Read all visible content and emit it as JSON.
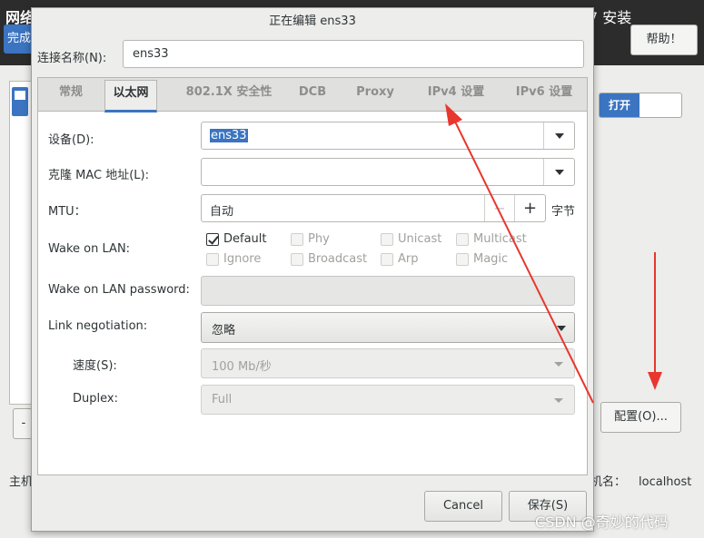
{
  "background": {
    "title_left": "网络和主机名",
    "done_button": "完成",
    "title_right": "7 安装",
    "help_button": "帮助！",
    "toggle_on_label": "打开",
    "minus_button": "-",
    "configure_button": "配置(O)...",
    "hostname_label_left": "主机",
    "hostname_label_right": "机名：",
    "hostname_value": "localhost"
  },
  "dialog": {
    "title": "正在编辑 ens33",
    "connection_name_label": "连接名称(N):",
    "connection_name_value": "ens33",
    "tabs": [
      "常规",
      "以太网",
      "802.1X 安全性",
      "DCB",
      "Proxy",
      "IPv4 设置",
      "IPv6 设置"
    ],
    "active_tab": "以太网",
    "device_label": "设备(D):",
    "device_value": "ens33",
    "clone_mac_label": "克隆 MAC 地址(L):",
    "clone_mac_value": "",
    "mtu_label": "MTU：",
    "mtu_value": "自动",
    "mtu_unit": "字节",
    "mtu_minus": "−",
    "mtu_plus": "+",
    "wol_label": "Wake on LAN:",
    "wol_options": [
      {
        "label": "Default",
        "checked": true,
        "enabled": true
      },
      {
        "label": "Phy",
        "checked": false,
        "enabled": false
      },
      {
        "label": "Unicast",
        "checked": false,
        "enabled": false
      },
      {
        "label": "Multicast",
        "checked": false,
        "enabled": false
      },
      {
        "label": "Ignore",
        "checked": false,
        "enabled": false
      },
      {
        "label": "Broadcast",
        "checked": false,
        "enabled": false
      },
      {
        "label": "Arp",
        "checked": false,
        "enabled": false
      },
      {
        "label": "Magic",
        "checked": false,
        "enabled": false
      }
    ],
    "wol_password_label": "Wake on LAN password:",
    "wol_password_value": "",
    "link_negotiation_label": "Link negotiation:",
    "link_negotiation_value": "忽略",
    "speed_label": "速度(S):",
    "speed_value": "100 Mb/秒",
    "duplex_label": "Duplex:",
    "duplex_value": "Full",
    "cancel_button": "Cancel",
    "save_button": "保存(S)"
  },
  "watermark": "CSDN @奇妙的代码",
  "colors": {
    "accent": "#3b74c1",
    "annotation_arrow": "#e8372e",
    "header_bg": "#2c2c2c"
  }
}
